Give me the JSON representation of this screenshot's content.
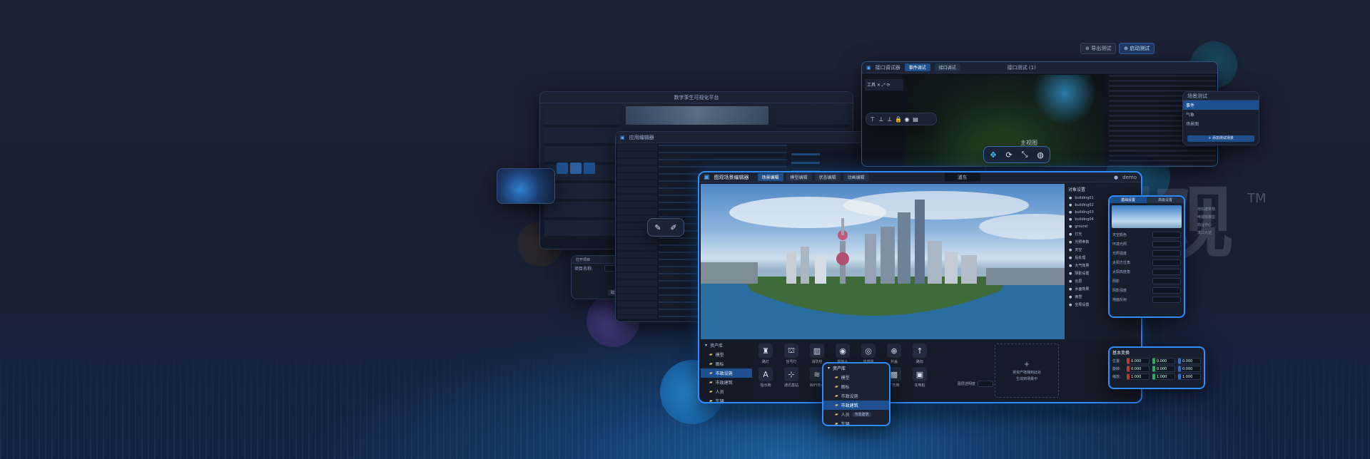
{
  "brand": {
    "logo_text": "图观",
    "tm": "TM"
  },
  "colors": {
    "accent": "#2f8cff",
    "panel": "#141a28",
    "highlight": "#1d4f91"
  },
  "top_badge": {
    "left": "导出测试",
    "right": "启动测试"
  },
  "code_window": {
    "title": "接口调试器",
    "tab_a": "事件调试",
    "tab_b": "接口调试",
    "center_title": "接口测试 (1)",
    "tool_label": "工具",
    "scene_label": "主视图"
  },
  "test_popup": {
    "title": "场景测试",
    "items": [
      "事件",
      "气象",
      "场景图"
    ],
    "button": "+ 添加测试场景"
  },
  "left_dashboard": {
    "title": "数字孪生可视化平台"
  },
  "dialog_small": {
    "title": "打开项目",
    "field_label": "项目名称:",
    "cancel": "取消",
    "ok": "确定"
  },
  "editor_mid": {
    "title": "应用编辑器"
  },
  "main_window": {
    "app_title": "图观场景编辑器",
    "tabs": [
      {
        "label": "场景编辑",
        "active": true
      },
      {
        "label": "模型编辑",
        "active": false
      },
      {
        "label": "状态编辑",
        "active": false
      },
      {
        "label": "动画编辑",
        "active": false
      }
    ],
    "center_label": "浦东",
    "user": "demo",
    "right_panel_title": "对象设置",
    "right_items": [
      "building01",
      "building02",
      "building03",
      "building04",
      "ground",
      "灯光",
      "光照参数",
      "天空",
      "后处理",
      "大气效果",
      "阴影设置",
      "云层",
      "水面效果",
      "雨雪",
      "全局设置"
    ],
    "tree_title": "资产库",
    "tree_items": [
      {
        "label": "模型",
        "sel": false
      },
      {
        "label": "图标",
        "sel": false
      },
      {
        "label": "市政设施",
        "sel": true
      },
      {
        "label": "市政建筑",
        "sel": false
      },
      {
        "label": "人员",
        "sel": false
      },
      {
        "label": "车辆",
        "sel": false
      },
      {
        "label": "飞行器",
        "sel": false
      }
    ],
    "assets": [
      {
        "icon": "♜",
        "label": "路灯"
      },
      {
        "icon": "⛫",
        "label": "信号灯"
      },
      {
        "icon": "▥",
        "label": "消防栓"
      },
      {
        "icon": "◉",
        "label": "摄像头"
      },
      {
        "icon": "◎",
        "label": "传感器"
      },
      {
        "icon": "⊕",
        "label": "井盖"
      },
      {
        "icon": "↑",
        "label": "路标"
      },
      {
        "icon": "A",
        "label": "指示牌"
      },
      {
        "icon": "⊹",
        "label": "通讯基站"
      },
      {
        "icon": "≋",
        "label": "WIFI热点"
      },
      {
        "icon": "▤",
        "label": "公交站"
      },
      {
        "icon": "▦",
        "label": "垃圾桶"
      },
      {
        "icon": "▩",
        "label": "广告牌"
      },
      {
        "icon": "▣",
        "label": "充电桩"
      }
    ],
    "drop_hint_line1": "将资产拖拽到此处",
    "drop_hint_line2": "生成到场景中",
    "opacity_label": "图层透明度"
  },
  "popup_tree": {
    "title": "资产库",
    "items": [
      {
        "label": "模型",
        "sel": false
      },
      {
        "label": "图标",
        "sel": false
      },
      {
        "label": "市政设施",
        "sel": false
      },
      {
        "label": "市政建筑",
        "sel": true
      },
      {
        "label": "人员",
        "sel": false,
        "badge": "市政建筑"
      },
      {
        "label": "车辆",
        "sel": false
      }
    ]
  },
  "props_panel": {
    "tab_a": "基础设置",
    "tab_b": "高级设置",
    "rows": [
      "天空颜色",
      "环境光照",
      "光照强度",
      "太阳方位角",
      "太阳高度角",
      "阴影",
      "阴影强度",
      "地面反射"
    ],
    "list": [
      "地标建筑物",
      "电视塔模型",
      "商业中心",
      "滨江大道"
    ]
  },
  "transform_panel": {
    "title": "基本变换",
    "rows": [
      {
        "label": "位置:",
        "x": "0.000",
        "y": "0.000",
        "z": "0.000"
      },
      {
        "label": "旋转:",
        "x": "0.000",
        "y": "0.000",
        "z": "0.000"
      },
      {
        "label": "缩放:",
        "x": "1.000",
        "y": "1.000",
        "z": "1.000"
      }
    ]
  },
  "floating_tools": {
    "a": "brush-icon",
    "b": "pen-icon"
  }
}
